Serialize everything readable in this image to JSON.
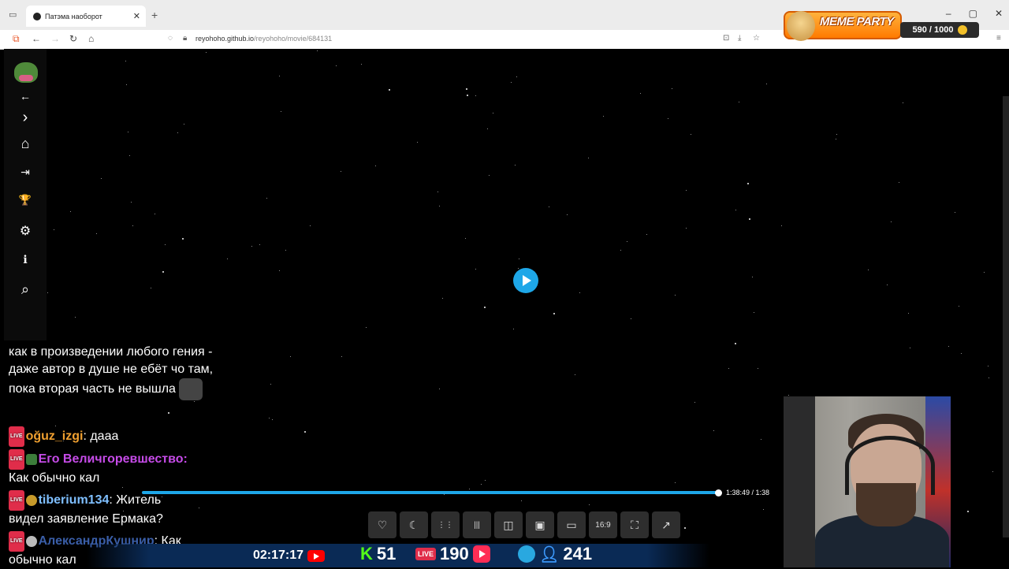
{
  "browser": {
    "tab_title": "Патэма наоборот",
    "tab_close": "✕",
    "new_tab": "+",
    "url_host": "reyohoho.github.io",
    "url_path": "/reyohoho/movie/684131"
  },
  "overlay": {
    "meme_title": "MEME PARTY",
    "meme_score": "590 / 1000"
  },
  "sidebar": {
    "items": [
      {
        "name": "back-arrow-icon",
        "glyph": "←"
      },
      {
        "name": "chevron-right-icon",
        "glyph": "›"
      },
      {
        "name": "home-icon",
        "glyph": "⌂"
      },
      {
        "name": "login-icon",
        "glyph": "⇥"
      },
      {
        "name": "trophy-icon",
        "glyph": "🏆"
      },
      {
        "name": "gear-icon",
        "glyph": "⚙"
      },
      {
        "name": "info-icon",
        "glyph": "ℹ"
      },
      {
        "name": "search-icon",
        "glyph": "⌕"
      }
    ]
  },
  "player": {
    "time": "1:38:49  /  1:38",
    "controls": [
      {
        "name": "favorite-button",
        "glyph": "♡"
      },
      {
        "name": "night-mode-button",
        "glyph": "☾"
      },
      {
        "name": "grid-button",
        "glyph": "⋮⋮"
      },
      {
        "name": "audio-button",
        "glyph": "|||"
      },
      {
        "name": "compare-button",
        "glyph": "◫"
      },
      {
        "name": "picture-button",
        "glyph": "▣"
      },
      {
        "name": "pip-button",
        "glyph": "▭"
      },
      {
        "name": "aspect-ratio-button",
        "glyph": "16:9"
      },
      {
        "name": "screenshot-button",
        "glyph": "⛶"
      },
      {
        "name": "open-external-button",
        "glyph": "↗"
      }
    ]
  },
  "chat": {
    "msg0": "как в произведении любого гения - даже автор в душе не ебёт чо там, пока вторая часть не вышла",
    "msg1_user": "oğuz_izgi",
    "msg1_text": ": дааа",
    "msg2_user": "Его Величгоревшество",
    "msg2_text": "Как обычно кал",
    "msg3_user": "tiberium134",
    "msg3_text": ": Житель видел заявление Ермака?",
    "msg4_user": "АлександрКушнир",
    "msg4_text": ": Как обычно кал",
    "live_label": "LIVE"
  },
  "stats": {
    "clock": "02:17:17",
    "kick_count": "51",
    "live_count": "190",
    "viewers": "241"
  }
}
